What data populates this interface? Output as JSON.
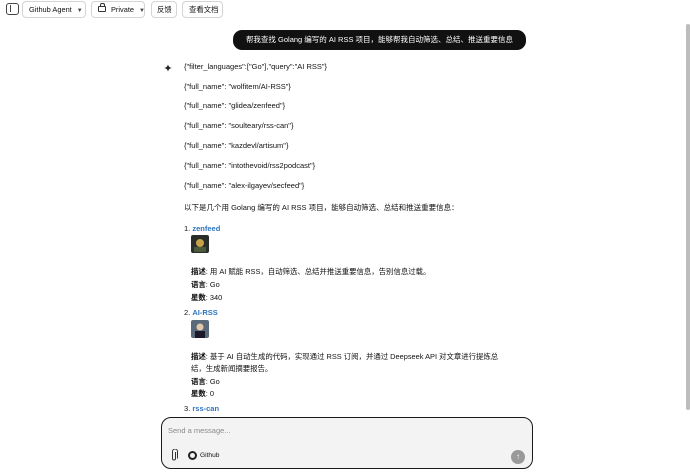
{
  "header": {
    "agent_select": "Github Agent",
    "visibility_select": "Private",
    "feedback_button": "反馈",
    "docs_button": "查看文档"
  },
  "conversation": {
    "user_message": "帮我查找 Golang 编写的 AI RSS 项目，能够帮我自动筛选、总结、推送重要信息",
    "tool_lines": [
      "{\"filter_languages\":[\"Go\"],\"query\":\"AI RSS\"}",
      "{\"full_name\": \"wolfitem/AI-RSS\"}",
      "{\"full_name\": \"glidea/zenfeed\"}",
      "{\"full_name\": \"soulteary/rss-can\"}",
      "{\"full_name\": \"kazdevl/artisum\"}",
      "{\"full_name\": \"intothevoid/rss2podcast\"}",
      "{\"full_name\": \"alex-ilgayev/secfeed\"}"
    ],
    "intro": "以下是几个用 Golang 编写的 AI RSS 项目，能够自动筛选、总结和推送重要信息：",
    "results": [
      {
        "number": "1.",
        "name": "zenfeed",
        "desc_label": "描述",
        "desc": ": 用 AI 赋能 RSS，自动筛选、总结并推送重要信息，告别信息过载。",
        "lang_label": "语言",
        "lang": ": Go",
        "stars_label": "星数",
        "stars": ": 340"
      },
      {
        "number": "2.",
        "name": "AI-RSS",
        "desc_label": "描述",
        "desc": ": 基于 AI 自动生成的代码，实现通过 RSS 订阅，并通过 Deepseek API 对文章进行提炼总",
        "desc_cont": "结，生成新闻摘要报告。",
        "lang_label": "语言",
        "lang": ": Go",
        "stars_label": "星数",
        "stars": ": 0"
      },
      {
        "number": "3.",
        "name": "rss-can"
      }
    ]
  },
  "composer": {
    "placeholder": "Send a message...",
    "github_chip": "Github"
  },
  "colors": {
    "link": "#2f74c0",
    "user_bubble": "#111111",
    "composer_bg": "#f3f3f3"
  }
}
